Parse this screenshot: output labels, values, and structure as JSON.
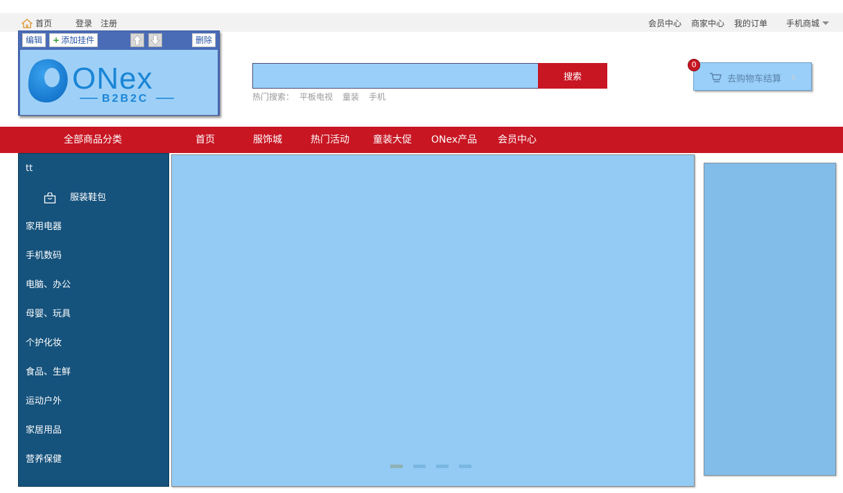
{
  "topbar": {
    "home": "首页",
    "login": "登录",
    "register": "注册",
    "member_center": "会员中心",
    "merchant_center": "商家中心",
    "my_orders": "我的订单",
    "mobile_mall": "手机商城"
  },
  "logo_widget": {
    "edit": "编辑",
    "add_widget": "添加挂件",
    "delete": "删除",
    "logo_main": "ONex",
    "logo_sub": "B2B2C"
  },
  "search": {
    "placeholder": "",
    "button": "搜索",
    "hot_label": "热门搜索：",
    "keywords": [
      "平板电视",
      "童装",
      "手机"
    ]
  },
  "cart": {
    "label": "去购物车结算",
    "count": "0"
  },
  "nav": {
    "all_categories": "全部商品分类",
    "items": [
      "首页",
      "服饰城",
      "热门活动",
      "童装大促",
      "ONex产品",
      "会员中心"
    ]
  },
  "categories": [
    "tt",
    "服装鞋包",
    "家用电器",
    "手机数码",
    "电脑、办公",
    "母婴、玩具",
    "个护化妆",
    "食品、生鲜",
    "运动户外",
    "家居用品",
    "营养保健"
  ],
  "carousel": {
    "slides": 4,
    "active": 0
  },
  "colors": {
    "brand_red": "#c81623",
    "sidebar_blue": "#15527c",
    "banner_blue": "#93cbf4",
    "logo_bg": "#9ed0f7"
  }
}
